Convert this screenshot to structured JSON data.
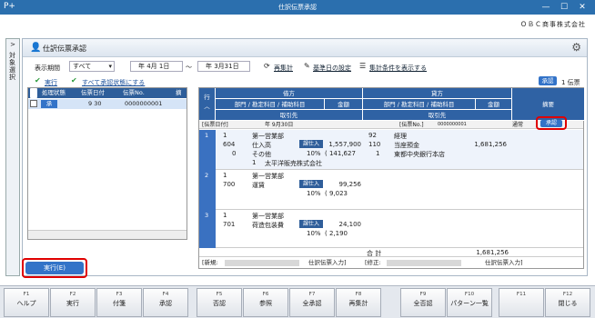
{
  "window": {
    "title": "仕訳伝票承認",
    "app_icon": "P+",
    "company": "ＯＢＣ商事株式会社"
  },
  "side_tab": {
    "arrow": ">",
    "label": "対象選択"
  },
  "panel": {
    "title": "仕訳伝票承認"
  },
  "filter": {
    "period_label": "表示期間",
    "period_value": "すべて",
    "from_date": "年 4月 1日",
    "tilde": "～",
    "to_date": "年 3月31日",
    "recalc": "再集計",
    "basedate": "基準日の設定",
    "show_cond": "集計条件を表示する"
  },
  "actions": {
    "execute": "実行",
    "make_all": "すべて承認状態にする"
  },
  "status": {
    "badge": "承認",
    "count": "1 伝票"
  },
  "list": {
    "headers": [
      "処理状態",
      "伝票日付",
      "伝票No.",
      "摘"
    ],
    "rows": [
      {
        "status": "承",
        "date": "9 30",
        "no": "0000000001"
      }
    ]
  },
  "exec_button": "実行(E)",
  "entry": {
    "row_header": "行",
    "debit": "借方",
    "credit": "貸方",
    "dept_label": "部門 / 勘定科目 / 補助科目",
    "amount": "金額",
    "partner": "取引先",
    "desc": "摘要",
    "date_label": "[伝票日付]",
    "date_value": "年 9月30日",
    "no_label": "[伝票No.]",
    "no_value": "0000000001",
    "type": "通常",
    "approve_btn": "承認",
    "lines": [
      {
        "no": "1",
        "d_dept_code": "1",
        "d_dept": "第一営業部",
        "d_acct_code": "604",
        "d_acct": "仕入高",
        "d_tax": "課仕入",
        "d_amount": "1,557,900",
        "d_sub_code": "0",
        "d_sub": "その他",
        "d_rate": "10%",
        "d_tax_amt": "( 141,627",
        "partner_code": "1",
        "partner": "太平洋販売株式会社",
        "c_dept_code": "92",
        "c_dept": "経理",
        "c_acct_code": "110",
        "c_acct": "当座預金",
        "c_amount": "1,681,256",
        "c_sub_code": "1",
        "c_sub": "東都中央銀行本店"
      },
      {
        "no": "2",
        "d_dept_code": "1",
        "d_dept": "第一営業部",
        "d_acct_code": "700",
        "d_acct": "運賃",
        "d_tax": "課仕入",
        "d_amount": "99,256",
        "d_rate": "10%",
        "d_tax_amt": "( 9,023"
      },
      {
        "no": "3",
        "d_dept_code": "1",
        "d_dept": "第一営業部",
        "d_acct_code": "701",
        "d_acct": "荷造包装費",
        "d_tax": "課仕入",
        "d_amount": "24,100",
        "d_rate": "10%",
        "d_tax_amt": "( 2,190"
      }
    ],
    "total_label": "合  計",
    "total_value": "1,681,256",
    "new_label": "[新規:",
    "new_value": "仕訳伝票入力]",
    "mod_label": "[修正:",
    "mod_value": "仕訳伝票入力]"
  },
  "fkeys": [
    {
      "k": "F1",
      "l": "ヘルプ"
    },
    {
      "k": "F2",
      "l": "実行"
    },
    {
      "k": "F3",
      "l": "付箋"
    },
    {
      "k": "F4",
      "l": "承認"
    },
    {
      "k": "F5",
      "l": "否認"
    },
    {
      "k": "F6",
      "l": "参照"
    },
    {
      "k": "F7",
      "l": "全承認"
    },
    {
      "k": "F8",
      "l": "再集計"
    },
    {
      "k": "F9",
      "l": "全否認"
    },
    {
      "k": "F10",
      "l": "パターン一覧"
    },
    {
      "k": "F11",
      "l": ""
    },
    {
      "k": "F12",
      "l": "閉じる"
    }
  ]
}
